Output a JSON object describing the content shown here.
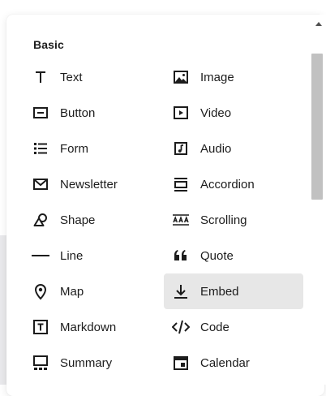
{
  "section": {
    "title": "Basic"
  },
  "items": [
    {
      "label": "Text",
      "icon": "text-icon"
    },
    {
      "label": "Image",
      "icon": "image-icon"
    },
    {
      "label": "Button",
      "icon": "button-icon"
    },
    {
      "label": "Video",
      "icon": "video-icon"
    },
    {
      "label": "Form",
      "icon": "form-icon"
    },
    {
      "label": "Audio",
      "icon": "audio-icon"
    },
    {
      "label": "Newsletter",
      "icon": "newsletter-icon"
    },
    {
      "label": "Accordion",
      "icon": "accordion-icon"
    },
    {
      "label": "Shape",
      "icon": "shape-icon"
    },
    {
      "label": "Scrolling",
      "icon": "scrolling-icon"
    },
    {
      "label": "Line",
      "icon": "line-icon"
    },
    {
      "label": "Quote",
      "icon": "quote-icon"
    },
    {
      "label": "Map",
      "icon": "map-pin-icon"
    },
    {
      "label": "Embed",
      "icon": "embed-icon",
      "selected": true
    },
    {
      "label": "Markdown",
      "icon": "markdown-icon"
    },
    {
      "label": "Code",
      "icon": "code-icon"
    },
    {
      "label": "Summary",
      "icon": "summary-icon"
    },
    {
      "label": "Calendar",
      "icon": "calendar-icon"
    }
  ],
  "colors": {
    "text": "#1c1c1c",
    "selected_bg": "#e7e7e7",
    "backdrop": "#e9e9ec",
    "scroll_thumb": "#c1c1c1"
  }
}
